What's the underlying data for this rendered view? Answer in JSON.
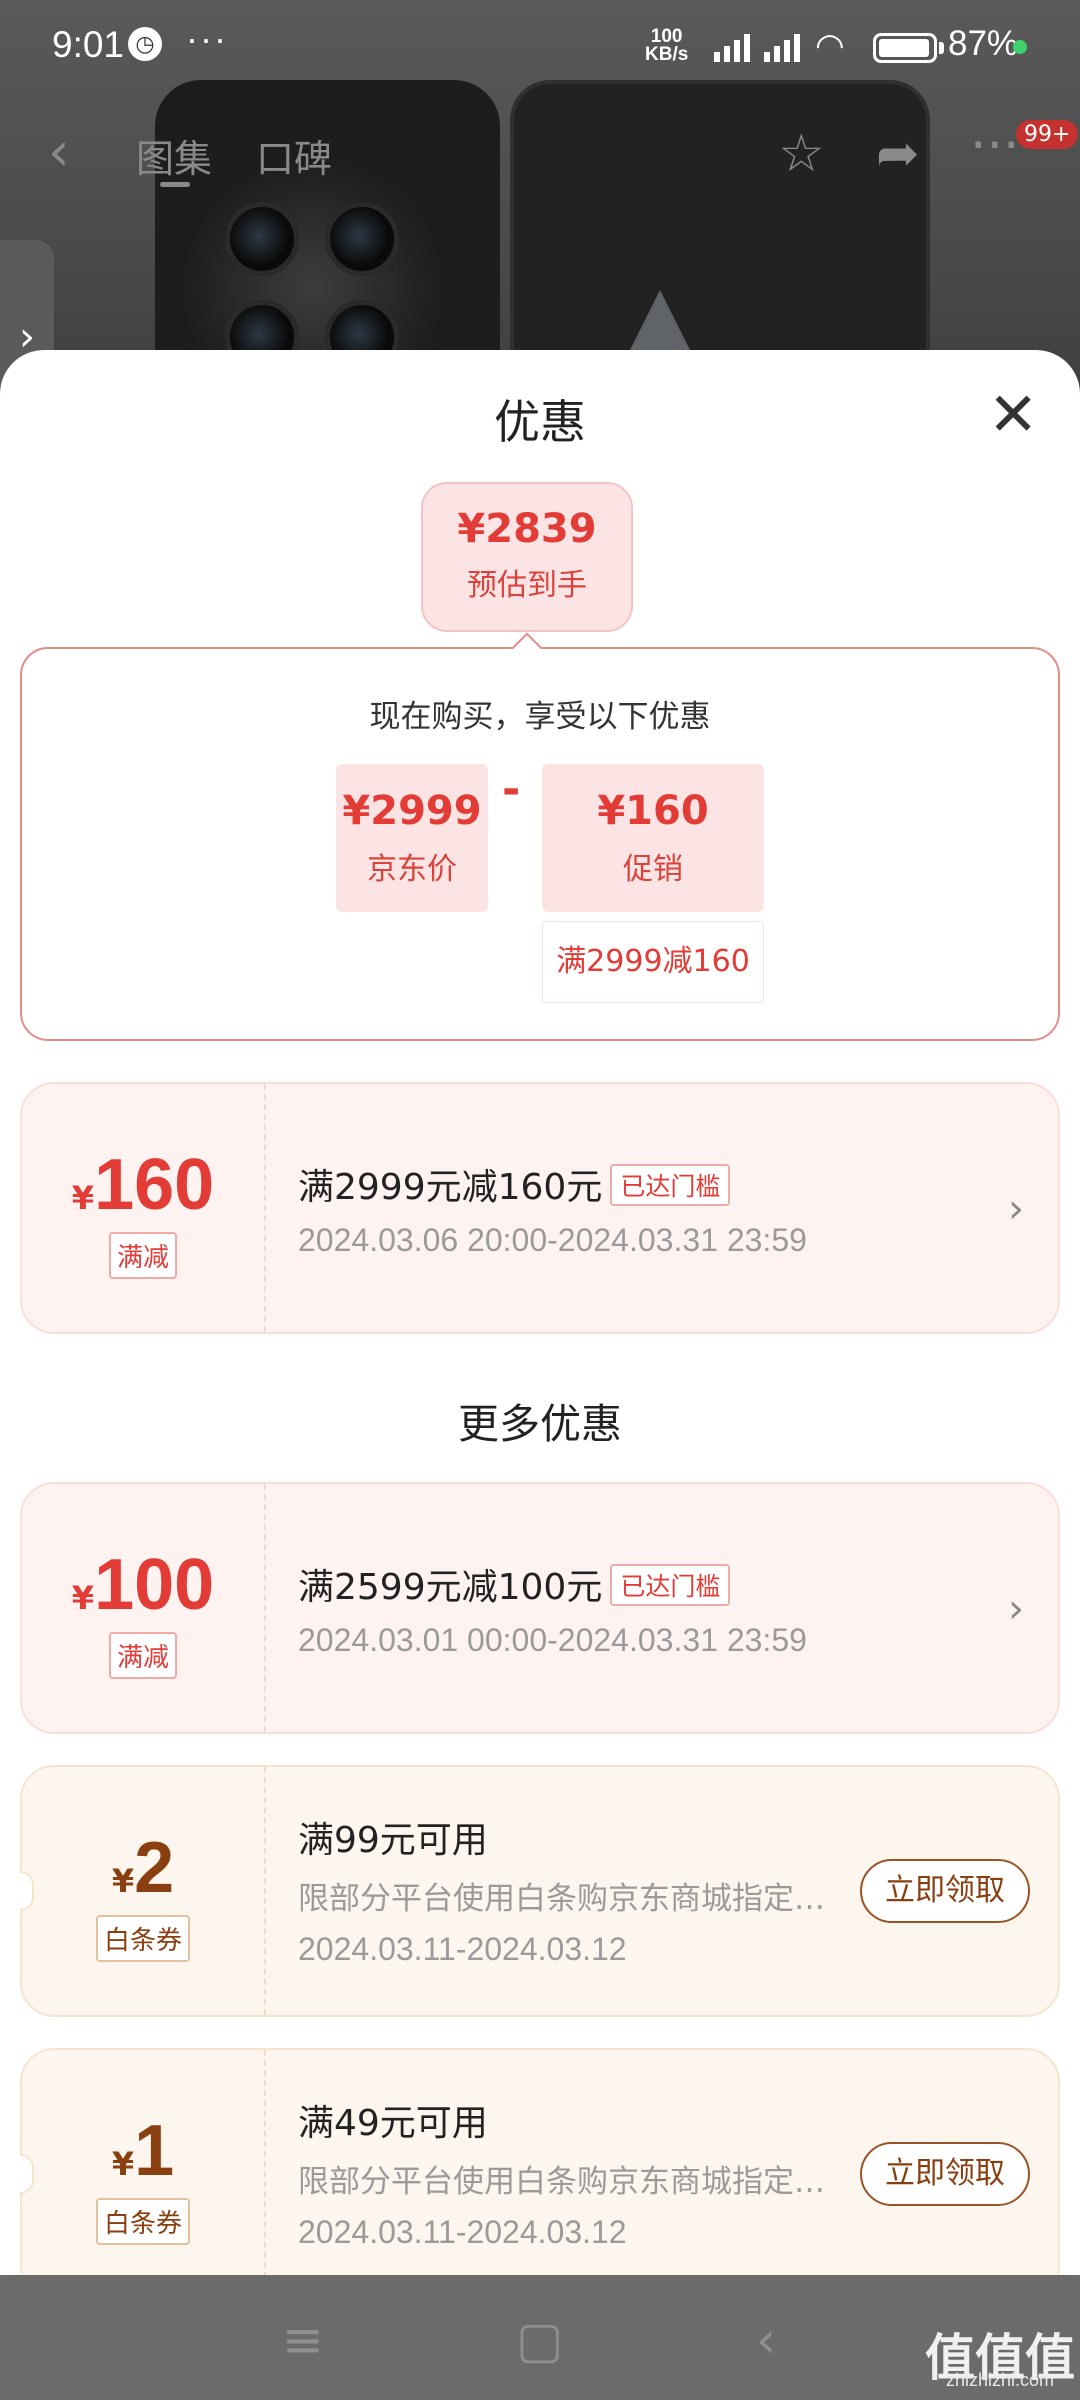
{
  "status_bar": {
    "time": "9:01",
    "dots": "···",
    "net_speed_value": "100",
    "net_speed_unit": "KB/s",
    "battery": "87%"
  },
  "top_nav": {
    "back_icon": "chevron-left-icon",
    "tabs": [
      "图集",
      "口碑"
    ],
    "badge": "99+"
  },
  "sheet": {
    "title": "优惠",
    "estimated": {
      "price": "¥2839",
      "label": "预估到手"
    },
    "calc": {
      "heading": "现在购买，享受以下优惠",
      "base_price": "¥2999",
      "base_label": "京东价",
      "minus": "-",
      "discount": "¥160",
      "discount_label": "促销",
      "discount_rule": "满2999减160"
    },
    "main_coupon": {
      "yen": "¥",
      "amount": "160",
      "tag": "满减",
      "title": "满2999元减160元",
      "status": "已达门槛",
      "dates": "2024.03.06 20:00-2024.03.31 23:59"
    },
    "more_title": "更多优惠",
    "more_coupons": [
      {
        "yen": "¥",
        "amount": "100",
        "tag": "满减",
        "title": "满2599元减100元",
        "status": "已达门槛",
        "dates": "2024.03.01 00:00-2024.03.31 23:59"
      },
      {
        "yen": "¥",
        "amount": "2",
        "tag": "白条券",
        "title": "满99元可用",
        "desc": "限部分平台使用白条购京东商城指定…",
        "dates": "2024.03.11-2024.03.12",
        "button": "立即领取"
      },
      {
        "yen": "¥",
        "amount": "1",
        "tag": "白条券",
        "title": "满49元可用",
        "desc": "限部分平台使用白条购京东商城指定…",
        "dates": "2024.03.11-2024.03.12",
        "button": "立即领取"
      }
    ]
  },
  "watermark": {
    "text": "值值值",
    "sub": "zhizhizhi.com"
  },
  "colors": {
    "accent_red": "#e33b36",
    "gold_brown": "#8a3f10",
    "pink_bg": "#fde4e4"
  }
}
